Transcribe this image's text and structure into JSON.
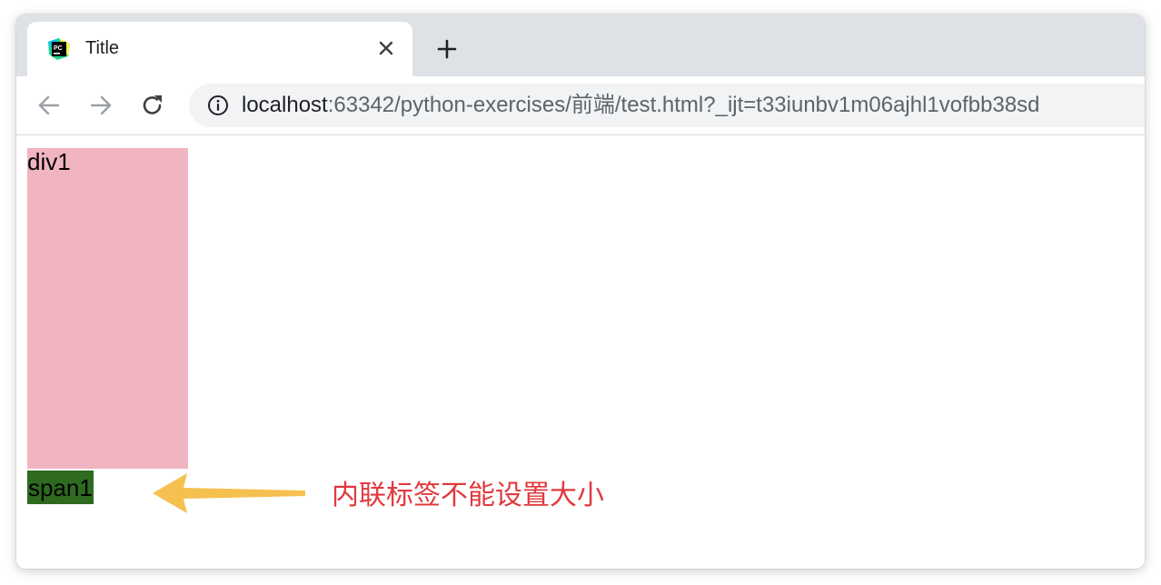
{
  "browser": {
    "tab": {
      "title": "Title",
      "favicon": "pycharm-icon"
    },
    "address_bar": {
      "host": "localhost",
      "path": ":63342/python-exercises/前端/test.html?_ijt=t33iunbv1m06ajhl1vofbb38sd"
    }
  },
  "page": {
    "div1_text": "div1",
    "div1_color": "#f1b5c1",
    "span1_text": "span1",
    "span1_color": "#2e6a20"
  },
  "annotation": {
    "text": "内联标签不能设置大小",
    "text_color": "#e0393e",
    "arrow_color": "#f5c04f"
  }
}
